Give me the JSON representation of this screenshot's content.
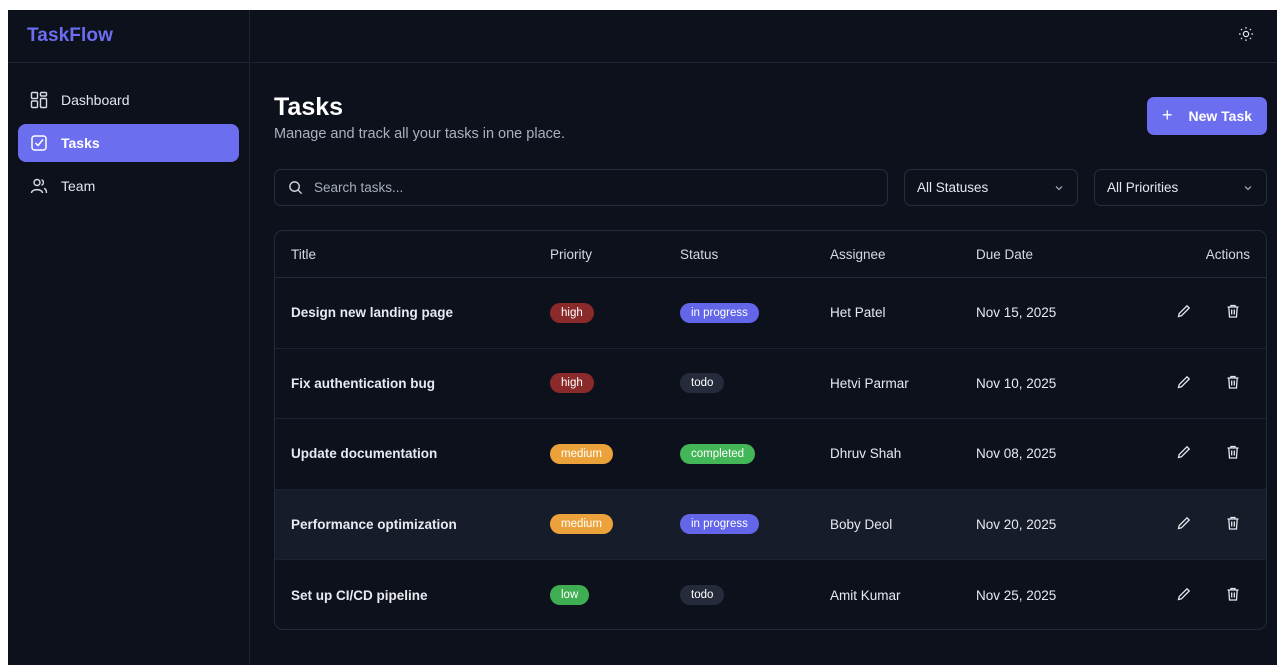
{
  "app": {
    "brand": "TaskFlow"
  },
  "sidebar": {
    "items": [
      {
        "label": "Dashboard",
        "icon": "dashboard-grid-icon",
        "active": false
      },
      {
        "label": "Tasks",
        "icon": "checkbox-icon",
        "active": true
      },
      {
        "label": "Team",
        "icon": "users-icon",
        "active": false
      }
    ]
  },
  "topbar": {
    "theme_icon": "sun-icon"
  },
  "page": {
    "title": "Tasks",
    "subtitle": "Manage and track all your tasks in one place.",
    "new_button": "New Task"
  },
  "filters": {
    "search_placeholder": "Search tasks...",
    "status_value": "All Statuses",
    "priority_value": "All Priorities"
  },
  "table": {
    "headers": {
      "title": "Title",
      "priority": "Priority",
      "status": "Status",
      "assignee": "Assignee",
      "due": "Due Date",
      "actions": "Actions"
    },
    "rows": [
      {
        "title": "Design new landing page",
        "priority": "high",
        "status": "in progress",
        "assignee": "Het Patel",
        "due": "Nov 15, 2025"
      },
      {
        "title": "Fix authentication bug",
        "priority": "high",
        "status": "todo",
        "assignee": "Hetvi Parmar",
        "due": "Nov 10, 2025"
      },
      {
        "title": "Update documentation",
        "priority": "medium",
        "status": "completed",
        "assignee": "Dhruv Shah",
        "due": "Nov 08, 2025"
      },
      {
        "title": "Performance optimization",
        "priority": "medium",
        "status": "in progress",
        "assignee": "Boby Deol",
        "due": "Nov 20, 2025"
      },
      {
        "title": "Set up CI/CD pipeline",
        "priority": "low",
        "status": "todo",
        "assignee": "Amit Kumar",
        "due": "Nov 25, 2025"
      }
    ]
  },
  "colors": {
    "accent": "#6c6ef0",
    "priority_high": "#8a2a2a",
    "priority_medium": "#eca23a",
    "priority_low": "#3fae52",
    "status_in_progress": "#6366e8",
    "status_todo": "#252b3a",
    "status_completed": "#43b657"
  }
}
